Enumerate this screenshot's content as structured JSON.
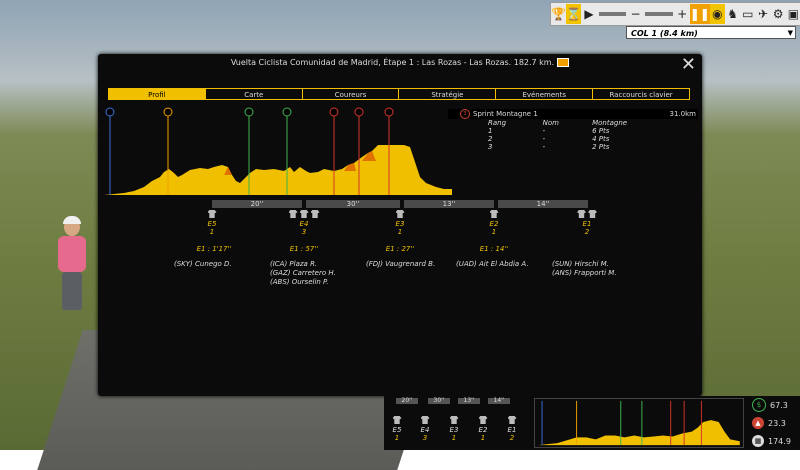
{
  "colors": {
    "accent": "#f0c000",
    "orange": "#f0a000",
    "green": "#3fb34f",
    "red": "#d4342b",
    "bg": "#0b0b0b"
  },
  "topbar": {
    "buttons": [
      "trophy-icon",
      "hourglass-icon",
      "play-icon",
      "minus-icon",
      "plus-icon",
      "pause-icon",
      "eye-icon",
      "motorbike-icon",
      "car-icon",
      "helicopter-icon",
      "bike-icon",
      "window-icon"
    ]
  },
  "climb_dropdown": {
    "value": "COL 1 (8.4 km)",
    "chevron": "▼"
  },
  "window": {
    "title": "Vuelta Ciclista Comunidad de Madrid, Étape 1 : Las Rozas - Las Rozas. 182.7 km.",
    "close": "✕",
    "tabs": [
      {
        "label": "Profil",
        "active": true
      },
      {
        "label": "Carte"
      },
      {
        "label": "Coureurs"
      },
      {
        "label": "Stratégie"
      },
      {
        "label": "Evénements"
      },
      {
        "label": "Raccourcis clavier"
      }
    ]
  },
  "profile": {
    "markers": [
      {
        "icon": "start-icon",
        "color": "#3b6fd6"
      },
      {
        "icon": "climb-icon",
        "color": "#f0a000"
      },
      {
        "icon": "sprint-icon",
        "color": "#3fb34f"
      },
      {
        "icon": "sprint-icon",
        "color": "#3fb34f"
      },
      {
        "icon": "climb-icon",
        "color": "#d4342b"
      },
      {
        "icon": "climb-icon",
        "color": "#d4342b"
      },
      {
        "icon": "climb-icon",
        "color": "#d4342b"
      }
    ]
  },
  "sprint": {
    "marker": "3",
    "title": "Sprint Montagne 1",
    "distance": "31.0km",
    "headers": [
      "Rang",
      "Nom",
      "Montagne"
    ],
    "rows": [
      [
        "1",
        "-",
        "6 Pts"
      ],
      [
        "2",
        "-",
        "4 Pts"
      ],
      [
        "3",
        "-",
        "2 Pts"
      ]
    ]
  },
  "gaps": [
    "20''",
    "30''",
    "13''",
    "14''"
  ],
  "groups": [
    {
      "id": "E5",
      "count": "1",
      "gap": "E1 : 1'17''",
      "riders": [
        "(SKY) Cunego D."
      ]
    },
    {
      "id": "E4",
      "count": "3",
      "gap": "E1 : 57''",
      "riders": [
        "(ICA) Plaza R.",
        "(GAZ) Carretero H.",
        "(ABS) Ourselin P."
      ]
    },
    {
      "id": "E3",
      "count": "1",
      "gap": "E1 : 27''",
      "riders": [
        "(FDJ) Vaugrenard B."
      ]
    },
    {
      "id": "E2",
      "count": "1",
      "gap": "E1 : 14''",
      "riders": [
        "(UAD) Ait El Abdia A."
      ]
    },
    {
      "id": "E1",
      "count": "2",
      "gap": "",
      "riders": [
        "(SUN) Hirschi M.",
        "(ANS) Frapporti M."
      ]
    }
  ],
  "mini": {
    "gaps": [
      "20''",
      "30''",
      "13''",
      "14''"
    ],
    "groups": [
      {
        "id": "E5",
        "count": "1"
      },
      {
        "id": "E4",
        "count": "3"
      },
      {
        "id": "E3",
        "count": "1"
      },
      {
        "id": "E2",
        "count": "1"
      },
      {
        "id": "E1",
        "count": "2"
      }
    ]
  },
  "stats": [
    {
      "icon": "sprint-points-icon",
      "value": "67.3"
    },
    {
      "icon": "mountain-icon",
      "value": "23.3"
    },
    {
      "icon": "finish-flag-icon",
      "value": "174.9"
    }
  ]
}
